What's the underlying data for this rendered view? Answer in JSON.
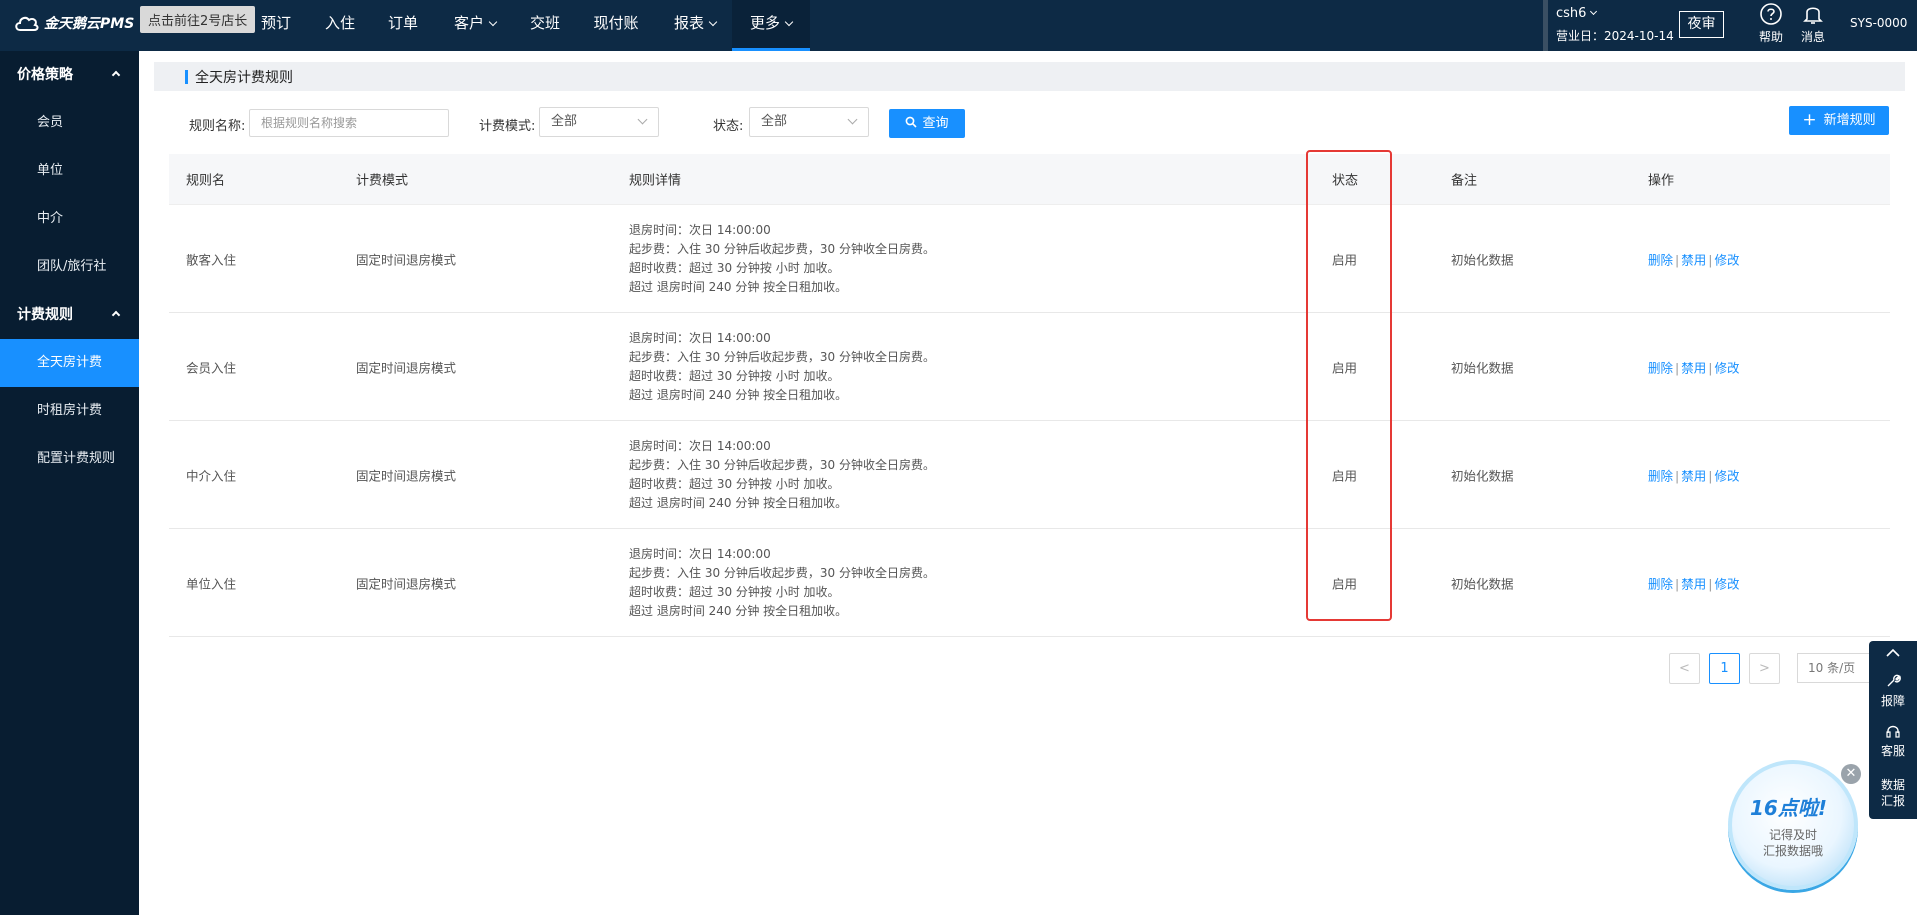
{
  "topbar": {
    "logo_text": "金天鹅云PMS",
    "tooltip": "点击前往2号店长",
    "nav": [
      "预订",
      "入住",
      "订单",
      "客户",
      "交班",
      "现付账",
      "报表",
      "更多"
    ],
    "account": "csh6",
    "business_date_label": "营业日：",
    "business_date": "2024-10-14",
    "night_audit": "夜审",
    "help": "帮助",
    "messages": "消息",
    "user": "SYS-0000"
  },
  "sidebar": {
    "group1": "价格策略",
    "group1_items": [
      "会员",
      "单位",
      "中介",
      "团队/旅行社"
    ],
    "group2": "计费规则",
    "group2_items": [
      "全天房计费",
      "时租房计费",
      "配置计费规则"
    ]
  },
  "page": {
    "title": "全天房计费规则"
  },
  "filters": {
    "rule_name_label": "规则名称:",
    "rule_name_placeholder": "根据规则名称搜索",
    "mode_label": "计费模式:",
    "mode_value": "全部",
    "status_label": "状态:",
    "status_value": "全部",
    "search_button": "查询",
    "add_button": "新增规则"
  },
  "table": {
    "headers": [
      "规则名",
      "计费模式",
      "规则详情",
      "状态",
      "备注",
      "操作"
    ],
    "rows": [
      {
        "name": "散客入住",
        "mode": "固定时间退房模式",
        "d1": "退房时间：次日 14:00:00",
        "d2": "起步费：入住 30 分钟后收起步费，30 分钟收全日房费。",
        "d3": "超时收费：超过 30 分钟按 小时 加收。",
        "d4": "超过 退房时间 240 分钟 按全日租加收。",
        "status": "启用",
        "note": "初始化数据",
        "op_delete": "删除",
        "op_disable": "禁用",
        "op_edit": "修改"
      },
      {
        "name": "会员入住",
        "mode": "固定时间退房模式",
        "d1": "退房时间：次日 14:00:00",
        "d2": "起步费：入住 30 分钟后收起步费，30 分钟收全日房费。",
        "d3": "超时收费：超过 30 分钟按 小时 加收。",
        "d4": "超过 退房时间 240 分钟 按全日租加收。",
        "status": "启用",
        "note": "初始化数据",
        "op_delete": "删除",
        "op_disable": "禁用",
        "op_edit": "修改"
      },
      {
        "name": "中介入住",
        "mode": "固定时间退房模式",
        "d1": "退房时间：次日 14:00:00",
        "d2": "起步费：入住 30 分钟后收起步费，30 分钟收全日房费。",
        "d3": "超时收费：超过 30 分钟按 小时 加收。",
        "d4": "超过 退房时间 240 分钟 按全日租加收。",
        "status": "启用",
        "note": "初始化数据",
        "op_delete": "删除",
        "op_disable": "禁用",
        "op_edit": "修改"
      },
      {
        "name": "单位入住",
        "mode": "固定时间退房模式",
        "d1": "退房时间：次日 14:00:00",
        "d2": "起步费：入住 30 分钟后收起步费，30 分钟收全日房费。",
        "d3": "超时收费：超过 30 分钟按 小时 加收。",
        "d4": "超过 退房时间 240 分钟 按全日租加收。",
        "status": "启用",
        "note": "初始化数据",
        "op_delete": "删除",
        "op_disable": "禁用",
        "op_edit": "修改"
      }
    ]
  },
  "pagination": {
    "prev": "<",
    "current": "1",
    "next": ">",
    "page_size": "10 条/页"
  },
  "float_panel": {
    "report_issue": "报障",
    "service": "客服",
    "data_report_1": "数据",
    "data_report_2": "汇报"
  },
  "promo": {
    "headline": "16点啦!",
    "line1": "记得及时",
    "line2": "汇报数据哦"
  },
  "colors": {
    "topbar": "#0d2a45",
    "sidebar": "#081d31",
    "accent": "#1890ff",
    "highlight": "#e53935"
  }
}
